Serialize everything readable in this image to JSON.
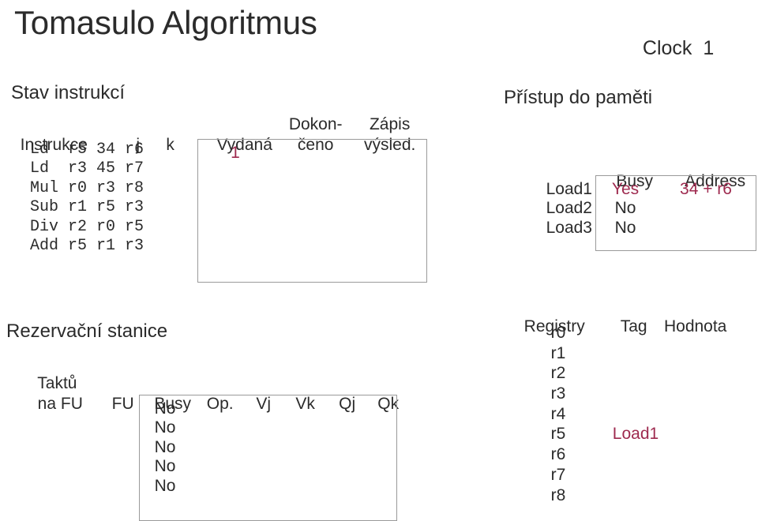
{
  "slide": {
    "title": "Tomasulo Algoritmus",
    "clock_label": "Clock",
    "clock_value": "1",
    "accent_color": "#9e2a4f",
    "text_color": "#2b2b2b",
    "border_color": "#9a9a9a"
  },
  "instruction_status": {
    "heading": "Stav instrukcí",
    "headers": {
      "instruction": "Instrukce",
      "j": "j",
      "k": "k",
      "issued": "Vydaná",
      "completed_top": "Dokon-",
      "completed_bottom": "čeno",
      "write_top": "Zápis",
      "write_bottom": "výsled."
    },
    "rows": [
      {
        "op": "Ld",
        "dest": "r5",
        "j": "34",
        "k": "r6",
        "issued": "1",
        "completed": "",
        "write": ""
      },
      {
        "op": "Ld",
        "dest": "r3",
        "j": "45",
        "k": "r7",
        "issued": "",
        "completed": "",
        "write": ""
      },
      {
        "op": "Mul",
        "dest": "r0",
        "j": "r3",
        "k": "r8",
        "issued": "",
        "completed": "",
        "write": ""
      },
      {
        "op": "Sub",
        "dest": "r1",
        "j": "r5",
        "k": "r3",
        "issued": "",
        "completed": "",
        "write": ""
      },
      {
        "op": "Div",
        "dest": "r2",
        "j": "r0",
        "k": "r5",
        "issued": "",
        "completed": "",
        "write": ""
      },
      {
        "op": "Add",
        "dest": "r5",
        "j": "r1",
        "k": "r3",
        "issued": "",
        "completed": "",
        "write": ""
      }
    ]
  },
  "reservation_stations": {
    "heading": "Rezervační stanice",
    "headers": {
      "cycles_top": "Taktů",
      "cycles_bottom": "na FU",
      "fu": "FU",
      "busy": "Busy",
      "op": "Op.",
      "vj": "Vj",
      "vk": "Vk",
      "qj": "Qj",
      "qk": "Qk"
    },
    "rows": [
      {
        "cycles": "",
        "fu": "",
        "busy": "No",
        "op": "",
        "vj": "",
        "vk": "",
        "qj": "",
        "qk": ""
      },
      {
        "cycles": "",
        "fu": "",
        "busy": "No",
        "op": "",
        "vj": "",
        "vk": "",
        "qj": "",
        "qk": ""
      },
      {
        "cycles": "",
        "fu": "",
        "busy": "No",
        "op": "",
        "vj": "",
        "vk": "",
        "qj": "",
        "qk": ""
      },
      {
        "cycles": "",
        "fu": "",
        "busy": "No",
        "op": "",
        "vj": "",
        "vk": "",
        "qj": "",
        "qk": ""
      },
      {
        "cycles": "",
        "fu": "",
        "busy": "No",
        "op": "",
        "vj": "",
        "vk": "",
        "qj": "",
        "qk": ""
      }
    ]
  },
  "memory_access": {
    "heading": "Přístup do paměti",
    "headers": {
      "busy": "Busy",
      "address": "Address"
    },
    "rows": [
      {
        "name": "Load1",
        "busy": "Yes",
        "busy_highlight": true,
        "address": "34 + r6",
        "address_highlight": true
      },
      {
        "name": "Load2",
        "busy": "No",
        "busy_highlight": false,
        "address": "",
        "address_highlight": false
      },
      {
        "name": "Load3",
        "busy": "No",
        "busy_highlight": false,
        "address": "",
        "address_highlight": false
      }
    ]
  },
  "registers": {
    "headers": {
      "registry": "Registry",
      "tag": "Tag",
      "value": "Hodnota"
    },
    "rows": [
      {
        "name": "r0",
        "tag": "",
        "tag_highlight": false,
        "value": ""
      },
      {
        "name": "r1",
        "tag": "",
        "tag_highlight": false,
        "value": ""
      },
      {
        "name": "r2",
        "tag": "",
        "tag_highlight": false,
        "value": ""
      },
      {
        "name": "r3",
        "tag": "",
        "tag_highlight": false,
        "value": ""
      },
      {
        "name": "r4",
        "tag": "",
        "tag_highlight": false,
        "value": ""
      },
      {
        "name": "r5",
        "tag": "Load1",
        "tag_highlight": true,
        "value": ""
      },
      {
        "name": "r6",
        "tag": "",
        "tag_highlight": false,
        "value": ""
      },
      {
        "name": "r7",
        "tag": "",
        "tag_highlight": false,
        "value": ""
      },
      {
        "name": "r8",
        "tag": "",
        "tag_highlight": false,
        "value": ""
      }
    ]
  }
}
